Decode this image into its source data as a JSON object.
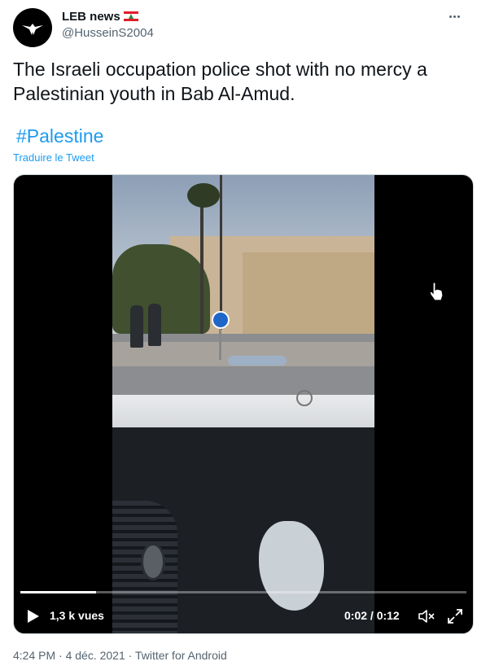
{
  "author": {
    "display_name": "LEB news",
    "handle": "@HusseinS2004",
    "flag": "lebanon-flag-icon",
    "avatar": "bird-logo-icon"
  },
  "tweet": {
    "text": "The Israeli occupation police shot with no mercy a Palestinian youth in Bab Al-Amud.",
    "hashtag": "#Palestine",
    "translate_label": "Traduire le Tweet"
  },
  "video": {
    "views": "1,3 k vues",
    "time": "0:02 / 0:12",
    "progress": 0.17,
    "controls": [
      "play-icon",
      "mute-icon",
      "fullscreen-icon"
    ]
  },
  "meta": {
    "timestamp": "4:24 PM · 4 déc. 2021 · Twitter for Android"
  },
  "colors": {
    "accent": "#1d9bf0",
    "text": "#0f1419",
    "muted": "#536471"
  }
}
